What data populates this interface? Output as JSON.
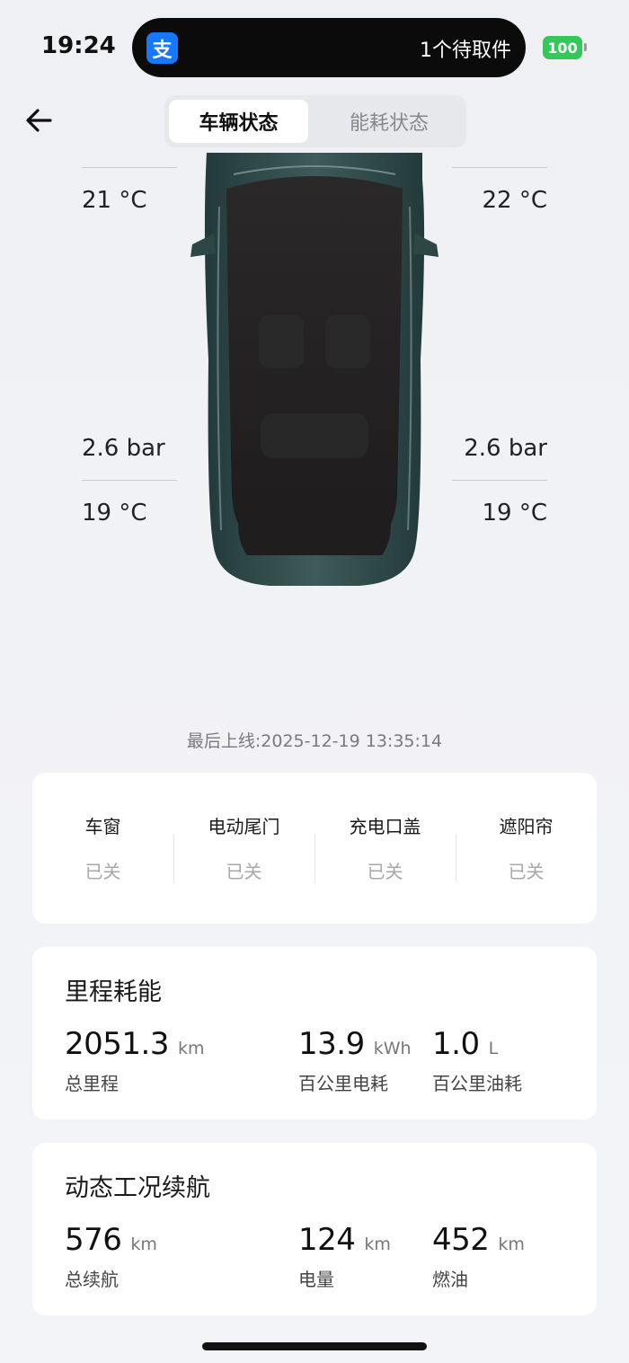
{
  "status_bar": {
    "time": "19:24",
    "island_app_glyph": "支",
    "island_text": "1个待取件",
    "battery": "100"
  },
  "nav": {
    "back_icon": "arrow-left-icon",
    "tabs": [
      {
        "label": "车辆状态",
        "active": true
      },
      {
        "label": "能耗状态",
        "active": false
      }
    ]
  },
  "tires": {
    "front_left": {
      "temp": "21 °C"
    },
    "front_right": {
      "temp": "22 °C"
    },
    "rear_left": {
      "pressure": "2.6 bar",
      "temp": "19 °C"
    },
    "rear_right": {
      "pressure": "2.6 bar",
      "temp": "19 °C"
    }
  },
  "last_online": "最后上线:2025-12-19 13:35:14",
  "closures": [
    {
      "label": "车窗",
      "value": "已关"
    },
    {
      "label": "电动尾门",
      "value": "已关"
    },
    {
      "label": "充电口盖",
      "value": "已关"
    },
    {
      "label": "遮阳帘",
      "value": "已关"
    }
  ],
  "mileage": {
    "title": "里程耗能",
    "total": {
      "value": "2051.3",
      "unit": "km",
      "label": "总里程"
    },
    "elec": {
      "value": "13.9",
      "unit": "kWh",
      "label": "百公里电耗"
    },
    "fuel": {
      "value": "1.0",
      "unit": "L",
      "label": "百公里油耗"
    }
  },
  "range": {
    "title": "动态工况续航",
    "total": {
      "value": "576",
      "unit": "km",
      "label": "总续航"
    },
    "elec": {
      "value": "124",
      "unit": "km",
      "label": "电量"
    },
    "fuel": {
      "value": "452",
      "unit": "km",
      "label": "燃油"
    }
  },
  "colors": {
    "car_body": "#2f4a4a",
    "accent_battery": "#34c759",
    "app_icon": "#1677ff"
  }
}
